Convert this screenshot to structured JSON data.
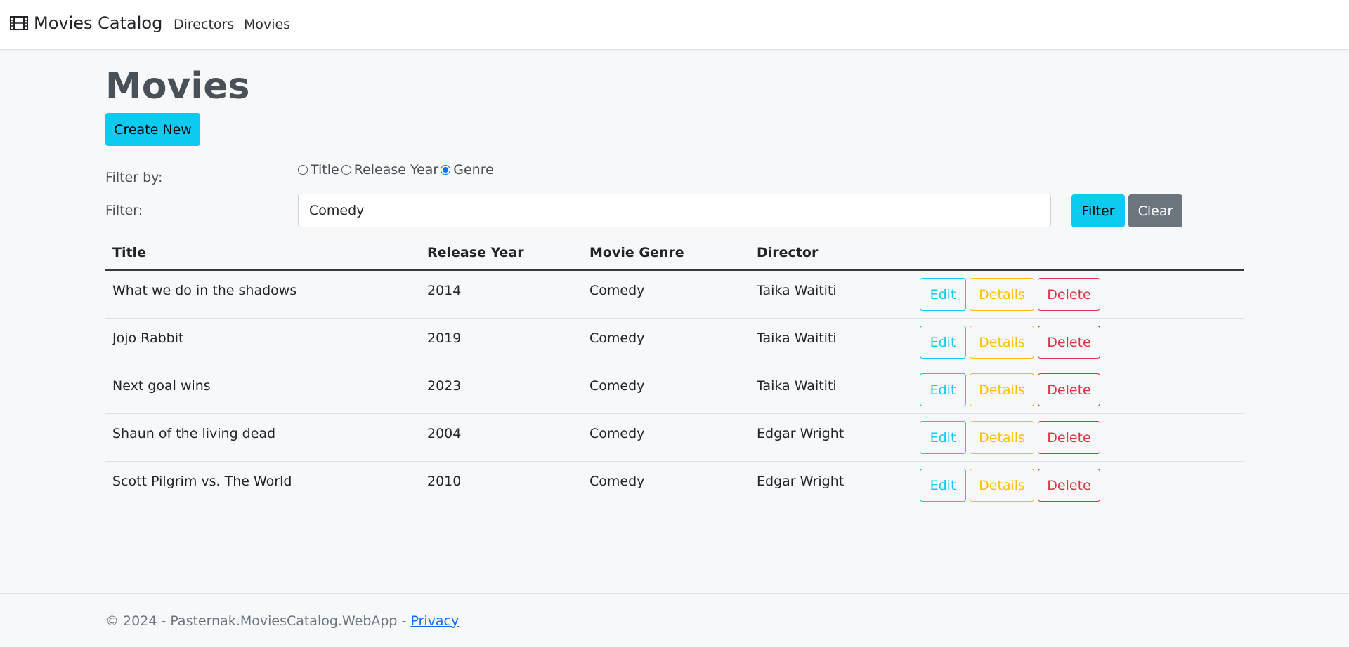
{
  "navbar": {
    "brand": "Movies Catalog",
    "brand_icon": "film-icon",
    "links": [
      "Directors",
      "Movies"
    ]
  },
  "main": {
    "title": "Movies",
    "create_button": "Create New",
    "filter_by_label": "Filter by:",
    "filter_options": [
      "Title",
      "Release Year",
      "Genre"
    ],
    "filter_selected": "Genre",
    "filter_label": "Filter:",
    "filter_value": "Comedy",
    "filter_button": "Filter",
    "clear_button": "Clear"
  },
  "table": {
    "headers": [
      "Title",
      "Release Year",
      "Movie Genre",
      "Director"
    ],
    "rows": [
      [
        "What we do in the shadows",
        "2014",
        "Comedy",
        "Taika Waititi"
      ],
      [
        "Jojo Rabbit",
        "2019",
        "Comedy",
        "Taika Waititi"
      ],
      [
        "Next goal wins",
        "2023",
        "Comedy",
        "Taika Waititi"
      ],
      [
        "Shaun of the living dead",
        "2004",
        "Comedy",
        "Edgar Wright"
      ],
      [
        "Scott Pilgrim vs. The World",
        "2010",
        "Comedy",
        "Edgar Wright"
      ]
    ],
    "actions": [
      "Edit",
      "Details",
      "Delete"
    ]
  },
  "footer": {
    "text": "© 2024 - Pasternak.MoviesCatalog.WebApp - ",
    "privacy_link": "Privacy"
  },
  "colors": {
    "info": "#0dcaf0",
    "warning": "#ffc107",
    "danger": "#dc3545",
    "secondary": "#6c757d",
    "link": "#0d6efd"
  }
}
